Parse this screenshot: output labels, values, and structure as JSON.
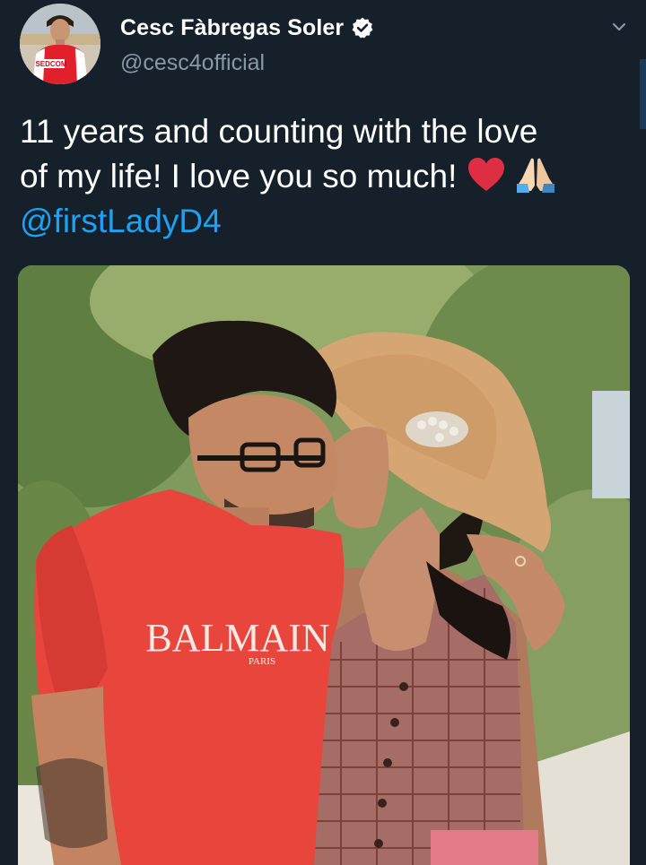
{
  "author": {
    "display_name": "Cesc Fàbregas Soler",
    "handle": "@cesc4official",
    "verified": true,
    "avatar_shirt_text": "SEDCOM"
  },
  "tweet": {
    "line1": "11 years and counting with the love",
    "line2": "of my life! I love you so much!",
    "emojis": [
      "red-heart",
      "folded-hands"
    ],
    "mention": "@firstLadyD4"
  },
  "media": {
    "shirt_brand": "BALMAIN",
    "shirt_sub": "PARIS"
  },
  "icons": {
    "verified": "verified-badge-icon",
    "more": "chevron-down-icon"
  },
  "colors": {
    "background": "#15202b",
    "text": "#ffffff",
    "secondary": "#8899a6",
    "link": "#1da1f2"
  }
}
